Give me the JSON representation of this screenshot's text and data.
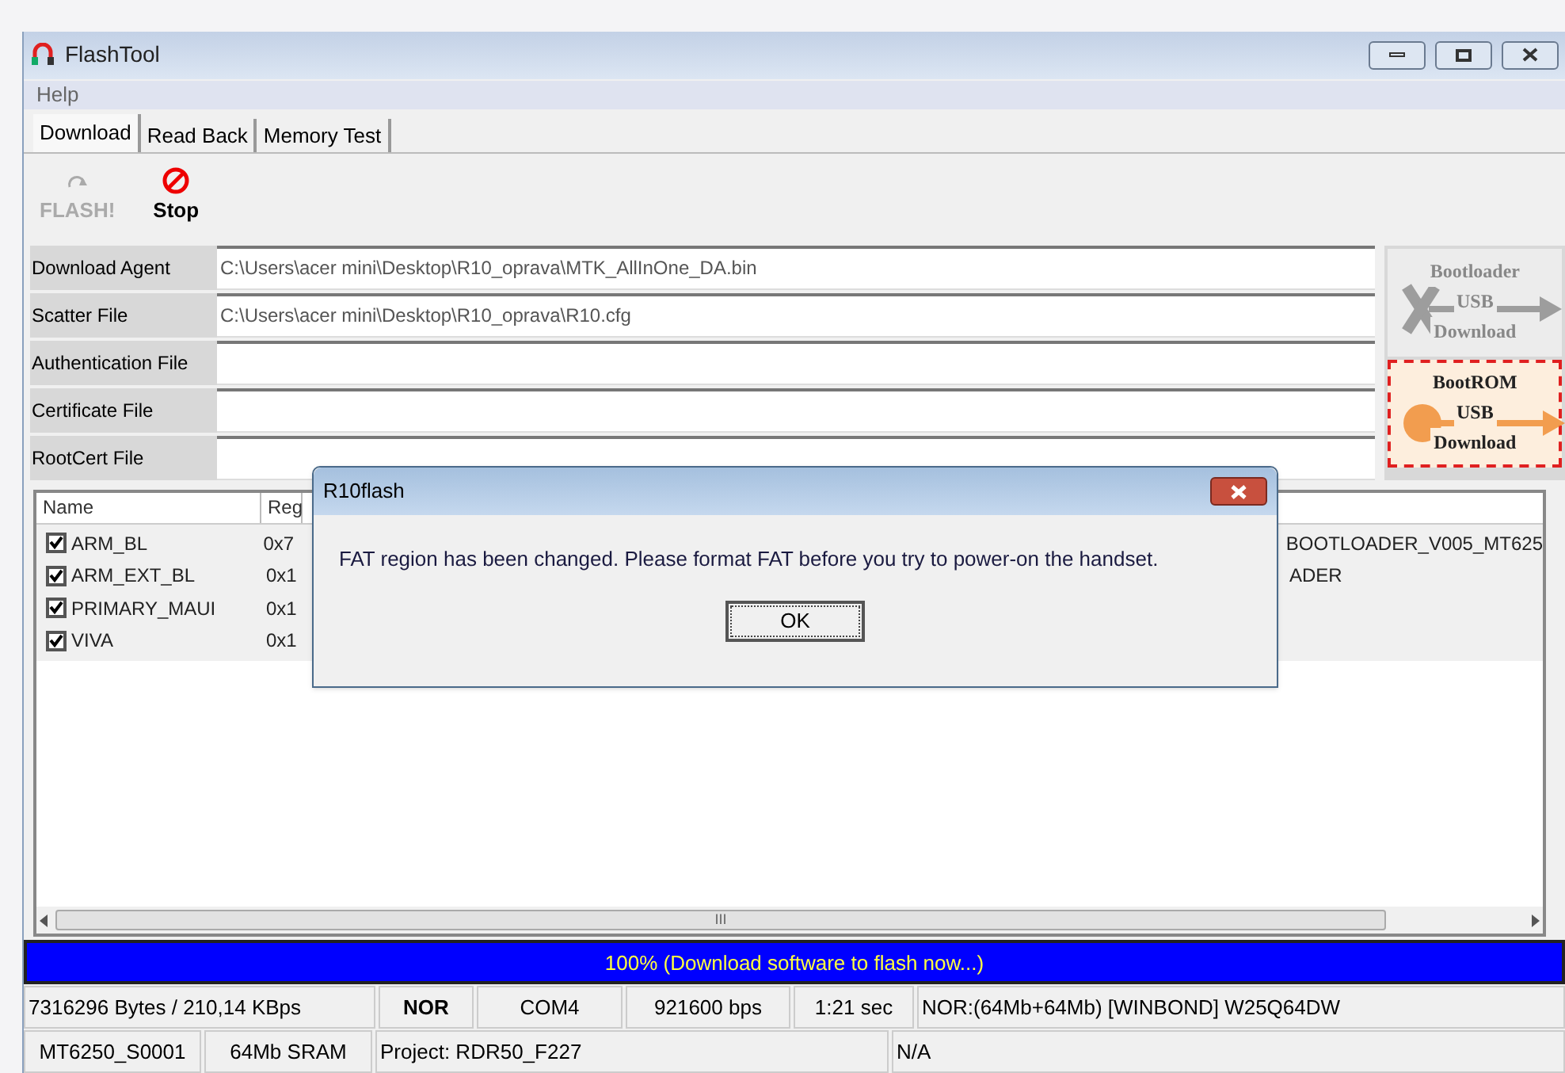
{
  "window": {
    "title": "FlashTool"
  },
  "menu": [
    "Help"
  ],
  "tabs": [
    {
      "label": "Download",
      "selected": true
    },
    {
      "label": "Read Back",
      "selected": false
    },
    {
      "label": "Memory Test",
      "selected": false
    }
  ],
  "toolbar": [
    {
      "kind": "flash",
      "label": "FLASH!",
      "disabled": true
    },
    {
      "kind": "stop",
      "label": "Stop",
      "disabled": false
    }
  ],
  "fields": [
    {
      "label": "Download Agent",
      "value": "C:\\Users\\acer mini\\Desktop\\R10_oprava\\MTK_AllInOne_DA.bin"
    },
    {
      "label": "Scatter File",
      "value": "C:\\Users\\acer mini\\Desktop\\R10_oprava\\R10.cfg"
    },
    {
      "label": "Authentication File"
    },
    {
      "label": "Certificate File"
    },
    {
      "label": "RootCert File"
    }
  ],
  "mode_buttons": [
    {
      "lines": [
        "Bootloader",
        "USB",
        "Download"
      ],
      "selected": false
    },
    {
      "lines": [
        "BootROM",
        "USB",
        "Download"
      ],
      "selected": true
    }
  ],
  "table": {
    "columns": [
      "Name",
      "Reg"
    ],
    "rows": [
      {
        "name": "ARM_BL",
        "checked": true,
        "column_2": "0x7",
        "column_3": "BOOTLOADER_V005_MT625"
      },
      {
        "name": "ARM_EXT_BL",
        "checked": true,
        "column_2": "0x1",
        "column_3": "ADER"
      },
      {
        "name": "PRIMARY_MAUI",
        "checked": true,
        "column_2": "0x1"
      },
      {
        "name": "VIVA",
        "checked": true,
        "column_2": "0x1"
      }
    ],
    "scroll_grip": "III"
  },
  "progress": {
    "text": "100% (Download software to flash now...)",
    "level": 1
  },
  "status_bar": {
    "row_1": [
      {
        "text": "7316296 Bytes / 210,14 KBps",
        "bold": false
      },
      {
        "text": "NOR",
        "bold": true
      },
      {
        "text": "COM4",
        "bold": false
      },
      {
        "text": "921600 bps",
        "bold": false
      },
      {
        "text": "1:21 sec",
        "bold": false
      },
      {
        "text": "NOR:(64Mb+64Mb) [WINBOND] W25Q64DW",
        "bold": false
      }
    ],
    "row_2": [
      {
        "text": "MT6250_S0001",
        "bold": false
      },
      {
        "text": "64Mb SRAM",
        "bold": false
      },
      {
        "text": "Project: RDR50_F227",
        "bold": false
      },
      {
        "text": "N/A",
        "bold": false
      }
    ]
  },
  "dialog": {
    "title": "R10flash",
    "message": "FAT region has been changed. Please format FAT before you try to power-on the handset.",
    "button": "OK"
  }
}
